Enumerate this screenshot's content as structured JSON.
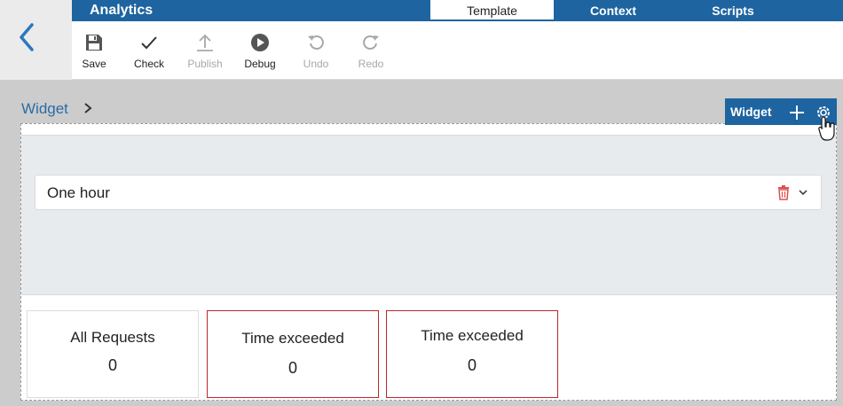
{
  "header": {
    "app_title": "Analytics"
  },
  "tabs": [
    {
      "label": "Template",
      "active": true
    },
    {
      "label": "Context",
      "active": false
    },
    {
      "label": "Scripts",
      "active": false
    }
  ],
  "toolbar": {
    "items": [
      {
        "label": "Save",
        "icon": "save-icon",
        "enabled": true
      },
      {
        "label": "Check",
        "icon": "check-icon",
        "enabled": true
      },
      {
        "label": "Publish",
        "icon": "publish-icon",
        "enabled": false
      },
      {
        "label": "Debug",
        "icon": "debug-icon",
        "enabled": true
      },
      {
        "label": "Undo",
        "icon": "undo-icon",
        "enabled": false
      },
      {
        "label": "Redo",
        "icon": "redo-icon",
        "enabled": false
      }
    ]
  },
  "breadcrumb": {
    "label": "Widget"
  },
  "widget_toolbar": {
    "label": "Widget"
  },
  "select": {
    "value": "One hour"
  },
  "cards": [
    {
      "title": "All Requests",
      "value": "0",
      "highlighted": false
    },
    {
      "title": "Time exceeded",
      "value": "0",
      "highlighted": true
    },
    {
      "title": "Time exceeded",
      "value": "0",
      "highlighted": true
    }
  ],
  "colors": {
    "header_blue": "#1d64a0",
    "link_blue": "#2a6ca8",
    "warning_red": "#b8272c",
    "trash_red": "#d9534f",
    "disabled_gray": "#a8a8a8"
  }
}
